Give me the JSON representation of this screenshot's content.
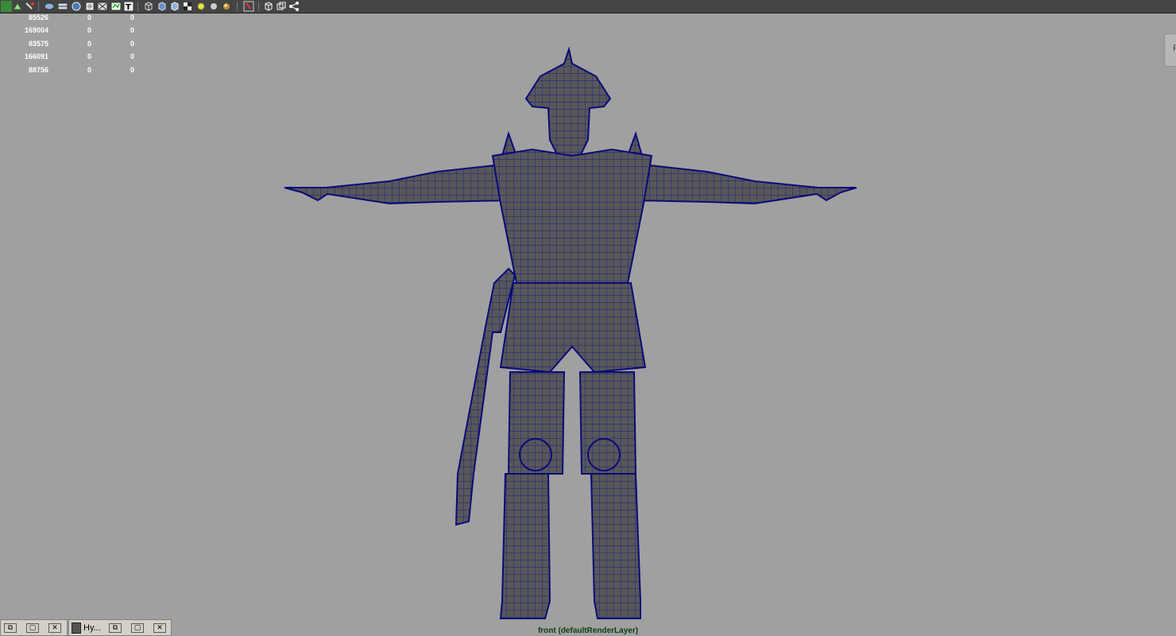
{
  "toolbar": {
    "icons": [
      "grid-icon",
      "snap-icon",
      "magnet-icon",
      "camera-icon",
      "film-icon",
      "sphere-icon",
      "sphere-flat-icon",
      "xray-icon",
      "grid-view-icon",
      "text-icon",
      "wire-cube-icon",
      "shaded-cube-icon",
      "textured-cube-icon",
      "checker-icon",
      "light-yellow-icon",
      "sphere-grey-icon",
      "sphere-shiny-icon",
      "select-highlight-icon",
      "cube-outline-icon",
      "copy-cube-icon",
      "share-icon"
    ]
  },
  "hud": {
    "rows": [
      {
        "c1": "85526",
        "c2": "0",
        "c3": "0"
      },
      {
        "c1": "169004",
        "c2": "0",
        "c3": "0"
      },
      {
        "c1": "83575",
        "c2": "0",
        "c3": "0"
      },
      {
        "c1": "166091",
        "c2": "0",
        "c3": "0"
      },
      {
        "c1": "88756",
        "c2": "0",
        "c3": "0"
      }
    ]
  },
  "right_tab": {
    "label": "F"
  },
  "camera": {
    "label": "front (defaultRenderLayer)"
  },
  "minimized": {
    "window2_title": "Hy..."
  },
  "colors": {
    "viewport_bg": "#a0a0a0",
    "wire": "#1a1a8c",
    "mesh": "#505050"
  }
}
